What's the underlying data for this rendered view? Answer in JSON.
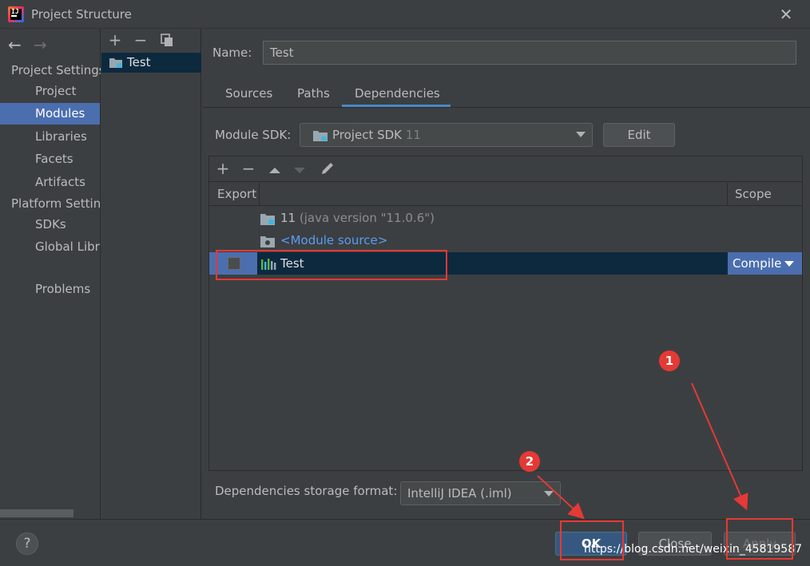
{
  "window": {
    "title": "Project Structure"
  },
  "nav": {
    "sections": [
      {
        "label": "Project Settings",
        "items": [
          "Project",
          "Modules",
          "Libraries",
          "Facets",
          "Artifacts"
        ]
      },
      {
        "label": "Platform Settings",
        "items": [
          "SDKs",
          "Global Libraries"
        ]
      }
    ],
    "problems": "Problems",
    "selected": "Modules"
  },
  "modules": {
    "items": [
      "Test"
    ]
  },
  "module_detail": {
    "name_label": "Name:",
    "name_value": "Test",
    "tabs": [
      "Sources",
      "Paths",
      "Dependencies"
    ],
    "active_tab": "Dependencies",
    "sdk_label": "Module SDK:",
    "sdk_value": "Project SDK",
    "sdk_version": "11",
    "edit_label": "Edit",
    "table": {
      "columns": {
        "export": "Export",
        "scope": "Scope"
      },
      "rows": [
        {
          "name": "11",
          "detail": "(java version \"11.0.6\")"
        },
        {
          "name": "<Module source>"
        },
        {
          "name": "Test",
          "scope": "Compile"
        }
      ]
    },
    "storage_label": "Dependencies storage format:",
    "storage_value": "IntelliJ IDEA (.iml)"
  },
  "footer": {
    "help": "?",
    "ok": "OK",
    "close": "Close",
    "apply": "Apply"
  },
  "annotations": {
    "badge_1": "1",
    "badge_2": "2"
  },
  "watermark": "https://blog.csdn.net/weixin_45819587",
  "colors": {
    "selection": "#4b6eaf",
    "row_highlight": "#0d293e",
    "annotation": "#e53935",
    "link": "#589df6"
  }
}
